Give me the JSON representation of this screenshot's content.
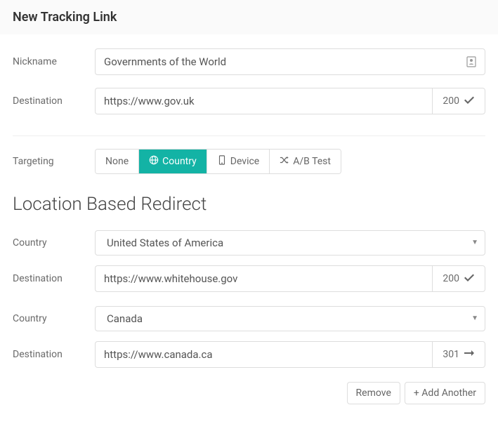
{
  "header": {
    "title": "New Tracking Link"
  },
  "form": {
    "nickname": {
      "label": "Nickname",
      "value": "Governments of the World"
    },
    "destination": {
      "label": "Destination",
      "value": "https://www.gov.uk",
      "status": "200"
    },
    "targeting": {
      "label": "Targeting",
      "options": {
        "none": "None",
        "country": "Country",
        "device": "Device",
        "abtest": "A/B Test"
      }
    }
  },
  "redirect_section": {
    "title": "Location Based Redirect",
    "country_label": "Country",
    "destination_label": "Destination",
    "entries": [
      {
        "country": "United States of America",
        "destination": "https://www.whitehouse.gov",
        "status": "200"
      },
      {
        "country": "Canada",
        "destination": "https://www.canada.ca",
        "status": "301"
      }
    ]
  },
  "actions": {
    "remove": "Remove",
    "add": "+ Add Another"
  }
}
